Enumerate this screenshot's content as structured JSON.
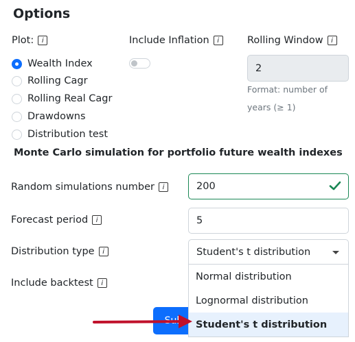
{
  "title": "Options",
  "info_glyph": "i",
  "plot": {
    "label": "Plot:",
    "options": [
      "Wealth Index",
      "Rolling Cagr",
      "Rolling Real Cagr",
      "Drawdowns",
      "Distribution test"
    ],
    "selected": "Wealth Index"
  },
  "inflation": {
    "label": "Include Inflation",
    "checked": false
  },
  "rolling": {
    "label": "Rolling Window",
    "value": "2",
    "help_line1": "Format: number of",
    "help_line2": "years (≥ 1)"
  },
  "monte_carlo": {
    "heading": "Monte Carlo simulation for portfolio future wealth indexes",
    "sims_label": "Random simulations number",
    "sims_value": "200",
    "forecast_label": "Forecast period",
    "forecast_value": "5",
    "dist_label": "Distribution type",
    "dist_value": "Student's t distribution",
    "backtest_label": "Include backtest",
    "dist_options": [
      "Normal distribution",
      "Lognormal distribution",
      "Student's t distribution"
    ]
  },
  "submit_label": "Sub",
  "colors": {
    "primary": "#0d6efd",
    "valid": "#198754",
    "arrow": "#c0112b",
    "selected_option_bg": "#e7f1fd"
  }
}
